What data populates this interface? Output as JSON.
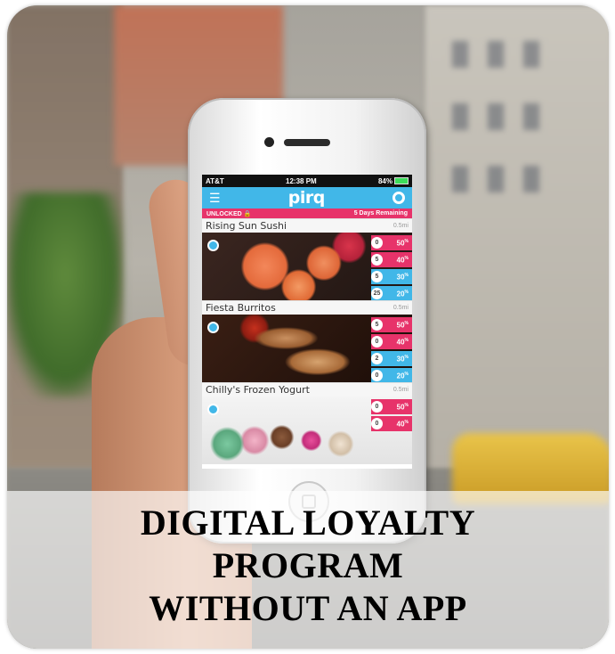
{
  "status_bar": {
    "carrier": "AT&T",
    "time": "12:38 PM",
    "battery": "84%"
  },
  "app": {
    "logo": "pirq",
    "menu_icon": "hamburger-icon",
    "profile_icon": "ring-icon"
  },
  "unlock_bar": {
    "status": "UNLOCKED",
    "remaining": "5 Days Remaining"
  },
  "listings": [
    {
      "name": "Rising Sun Sushi",
      "distance": "0.5mi",
      "tiers": [
        {
          "badge": "0",
          "pct": "50",
          "color": "pink"
        },
        {
          "badge": "5",
          "pct": "40",
          "color": "pink"
        },
        {
          "badge": "5",
          "pct": "30",
          "color": "blue"
        },
        {
          "badge": "25",
          "pct": "20",
          "color": "blue"
        }
      ]
    },
    {
      "name": "Fiesta Burritos",
      "distance": "0.5mi",
      "tiers": [
        {
          "badge": "5",
          "pct": "50",
          "color": "pink"
        },
        {
          "badge": "0",
          "pct": "40",
          "color": "pink"
        },
        {
          "badge": "2",
          "pct": "30",
          "color": "blue"
        },
        {
          "badge": "0",
          "pct": "20",
          "color": "blue"
        }
      ]
    },
    {
      "name": "Chilly's Frozen Yogurt",
      "distance": "0.5mi",
      "tiers": [
        {
          "badge": "0",
          "pct": "50",
          "color": "pink"
        },
        {
          "badge": "0",
          "pct": "40",
          "color": "pink"
        }
      ]
    }
  ],
  "percent_suffix": "%",
  "headline": {
    "line1": "DIGITAL LOYALTY",
    "line2": "PROGRAM",
    "line3": "WITHOUT AN APP"
  }
}
